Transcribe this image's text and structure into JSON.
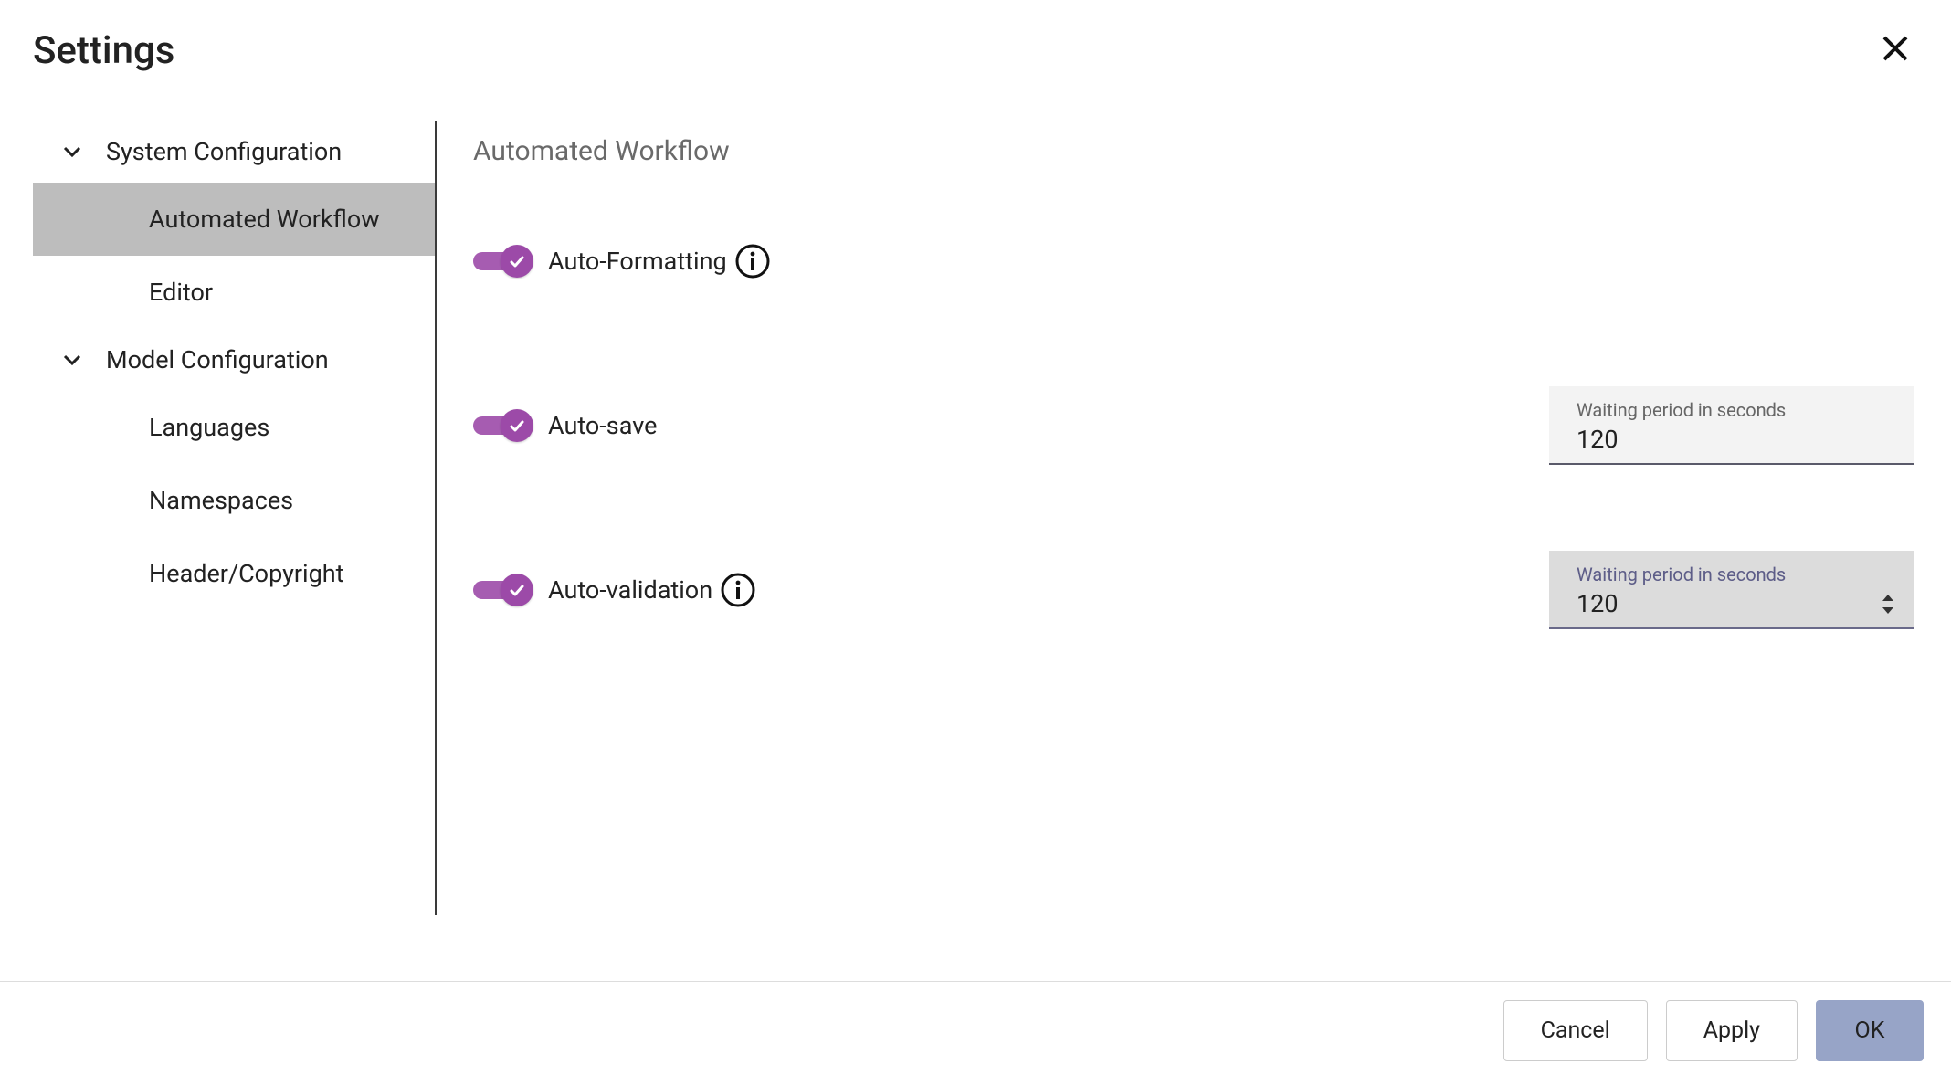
{
  "header": {
    "title": "Settings"
  },
  "sidebar": {
    "groups": [
      {
        "title": "System Configuration",
        "items": [
          {
            "label": "Automated Workflow",
            "active": true
          },
          {
            "label": "Editor",
            "active": false
          }
        ]
      },
      {
        "title": "Model Configuration",
        "items": [
          {
            "label": "Languages",
            "active": false
          },
          {
            "label": "Namespaces",
            "active": false
          },
          {
            "label": "Header/Copyright",
            "active": false
          }
        ]
      }
    ]
  },
  "main": {
    "title": "Automated Workflow",
    "settings": {
      "auto_formatting_label": "Auto-Formatting",
      "auto_save_label": "Auto-save",
      "auto_validation_label": "Auto-validation"
    },
    "inputs": {
      "autosave": {
        "label": "Waiting period in seconds",
        "value": "120"
      },
      "autovalidation": {
        "label": "Waiting period in seconds",
        "value": "120"
      }
    }
  },
  "footer": {
    "cancel_label": "Cancel",
    "apply_label": "Apply",
    "ok_label": "OK"
  }
}
